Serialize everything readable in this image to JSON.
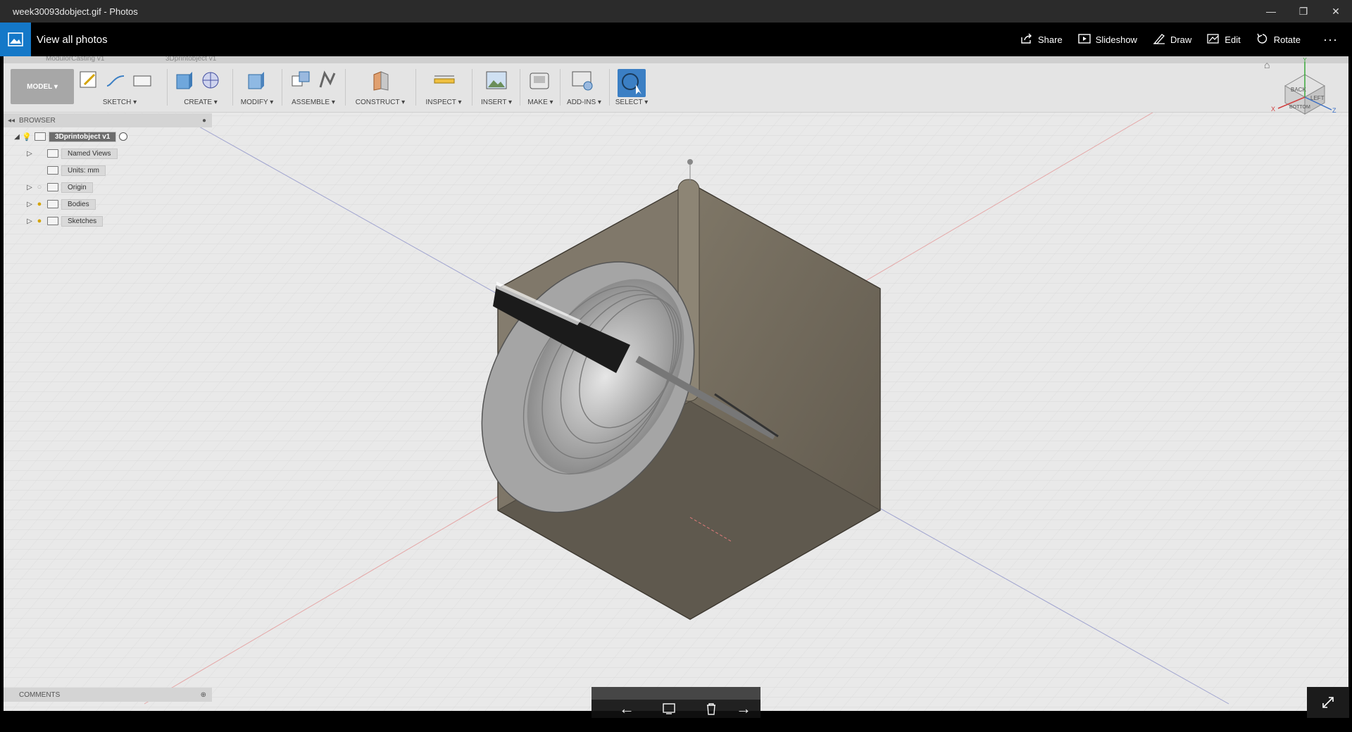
{
  "window": {
    "title": "week30093dobject.gif - Photos",
    "minimize": "—",
    "restore": "❐",
    "close": "✕"
  },
  "appbar": {
    "view_all": "View all photos",
    "actions": [
      {
        "label": "Share",
        "icon": "share-icon"
      },
      {
        "label": "Slideshow",
        "icon": "slideshow-icon"
      },
      {
        "label": "Draw",
        "icon": "draw-icon"
      },
      {
        "label": "Edit",
        "icon": "edit-icon"
      },
      {
        "label": "Rotate",
        "icon": "rotate-icon"
      }
    ],
    "more": "···"
  },
  "fusion": {
    "doc_tabs": [
      "ModulorCasting v1",
      "3Dprintobject v1"
    ],
    "workspace": "MODEL ▾",
    "groups": [
      {
        "label": "SKETCH ▾"
      },
      {
        "label": "CREATE ▾"
      },
      {
        "label": "MODIFY ▾"
      },
      {
        "label": "ASSEMBLE ▾"
      },
      {
        "label": "CONSTRUCT ▾"
      },
      {
        "label": "INSPECT ▾"
      },
      {
        "label": "INSERT ▾"
      },
      {
        "label": "MAKE ▾"
      },
      {
        "label": "ADD-INS ▾"
      },
      {
        "label": "SELECT ▾"
      }
    ],
    "browser": {
      "title": "BROWSER",
      "root": "3Dprintobject v1",
      "items": [
        "Named Views",
        "Units: mm",
        "Origin",
        "Bodies",
        "Sketches"
      ]
    },
    "comments": "COMMENTS",
    "viewcube": {
      "top": "BACK",
      "right": "LEFT",
      "front": "BOTTOM",
      "x": "X",
      "y": "Y",
      "z": "Z"
    }
  },
  "nav": {
    "prev": "←",
    "next": "→"
  },
  "colors": {
    "accent": "#1478c8",
    "select_blue": "#3b7fc4",
    "model_gray": "#6e6658"
  }
}
